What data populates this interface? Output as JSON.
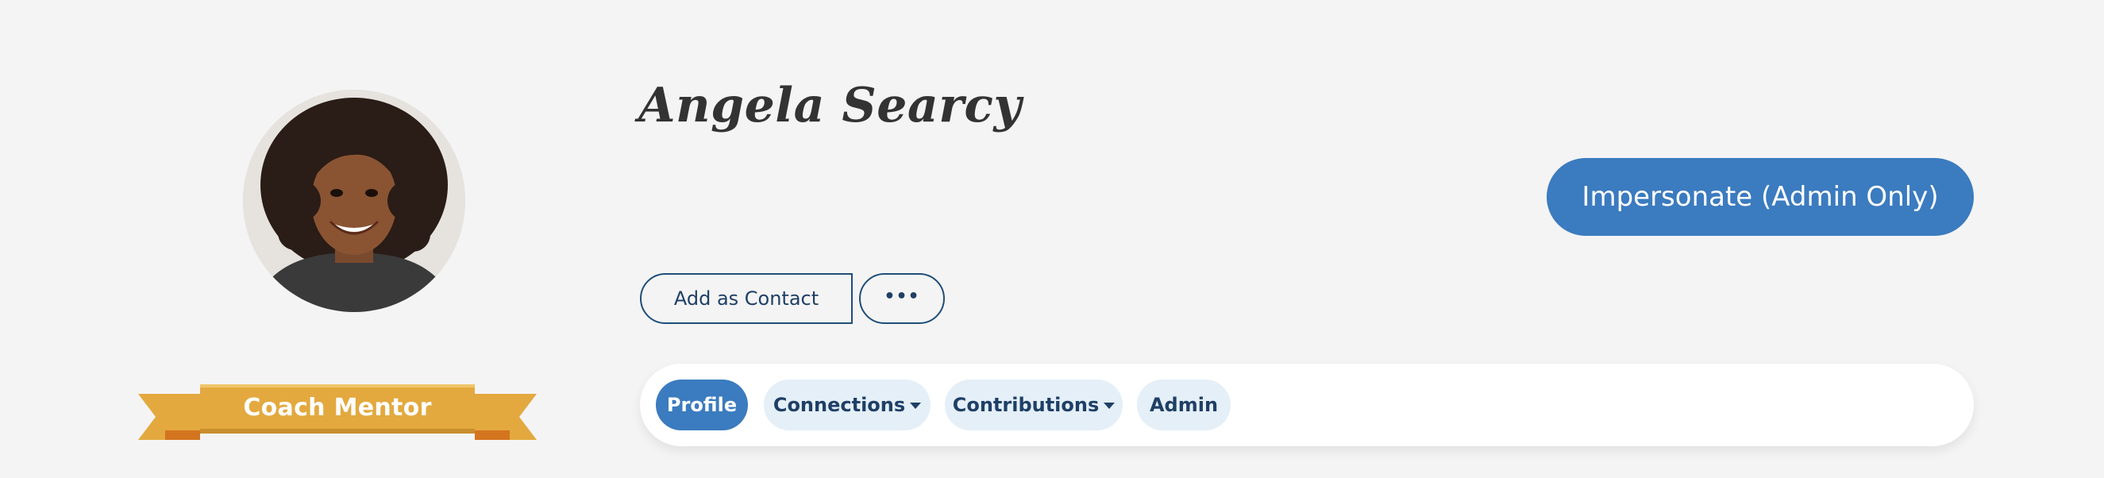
{
  "profile": {
    "name": "Angela Searcy",
    "badge": "Coach Mentor"
  },
  "actions": {
    "impersonate": "Impersonate (Admin Only)",
    "add_contact": "Add as Contact",
    "more": "•••"
  },
  "tabs": [
    {
      "label": "Profile",
      "active": true,
      "dropdown": false
    },
    {
      "label": "Connections",
      "active": false,
      "dropdown": true
    },
    {
      "label": "Contributions",
      "active": false,
      "dropdown": true
    },
    {
      "label": "Admin",
      "active": false,
      "dropdown": false
    }
  ],
  "colors": {
    "background": "#f4f4f4",
    "primary": "#3b7bbf",
    "tab_inactive": "#e4eff8",
    "badge_gold": "#e3a93f",
    "badge_dark": "#d4741f",
    "text_dark": "#1f3f66"
  }
}
